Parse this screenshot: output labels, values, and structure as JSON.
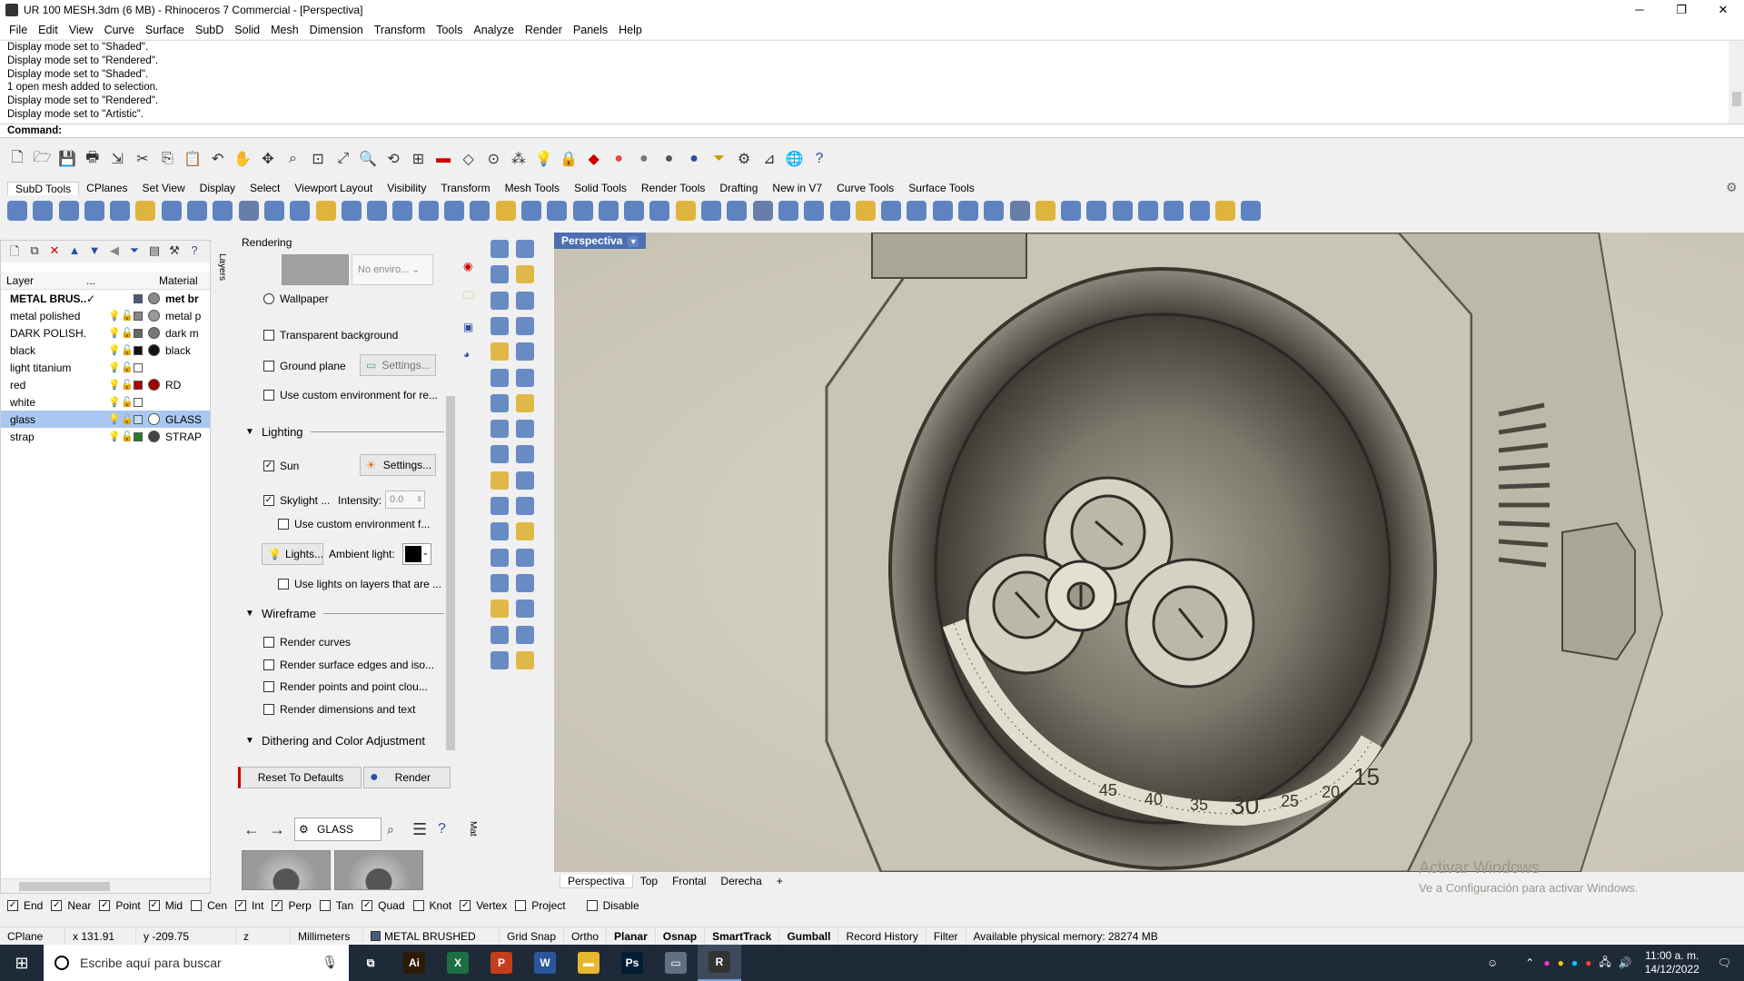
{
  "window": {
    "title": "UR 100 MESH.3dm (6 MB) - Rhinoceros 7 Commercial - [Perspectiva]",
    "minimize": "─",
    "maximize": "❐",
    "close": "✕"
  },
  "menu": [
    "File",
    "Edit",
    "View",
    "Curve",
    "Surface",
    "SubD",
    "Solid",
    "Mesh",
    "Dimension",
    "Transform",
    "Tools",
    "Analyze",
    "Render",
    "Panels",
    "Help"
  ],
  "history": [
    "Display mode set to \"Shaded\".",
    "Display mode set to \"Rendered\".",
    "Display mode set to \"Shaded\".",
    "1 open mesh added to selection.",
    "Display mode set to \"Rendered\".",
    "Display mode set to \"Artistic\"."
  ],
  "command": {
    "label": "Command:",
    "value": ""
  },
  "toolbar_tabs": [
    "SubD Tools",
    "CPlanes",
    "Set View",
    "Display",
    "Select",
    "Viewport Layout",
    "Visibility",
    "Transform",
    "Mesh Tools",
    "Solid Tools",
    "Render Tools",
    "Drafting",
    "New in V7",
    "Curve Tools",
    "Surface Tools"
  ],
  "layers": {
    "headers": {
      "layer": "Layer",
      "cur": "...",
      "material": "Material"
    },
    "rows": [
      {
        "name": "METAL BRUS...",
        "current": "✓",
        "color": "#4a5a7a",
        "mat_color": "#8a8a8a",
        "material": "met br",
        "bold": true,
        "selected": false
      },
      {
        "name": "metal polished",
        "current": "",
        "color": "#888888",
        "mat_color": "#999999",
        "material": "metal p",
        "bold": false,
        "selected": false
      },
      {
        "name": "DARK POLISH...",
        "current": "",
        "color": "#666666",
        "mat_color": "#777777",
        "material": "dark m",
        "bold": false,
        "selected": false
      },
      {
        "name": "black",
        "current": "",
        "color": "#111111",
        "mat_color": "#111111",
        "material": "black",
        "bold": false,
        "selected": false
      },
      {
        "name": "light titanium",
        "current": "",
        "color": "#ffffff",
        "mat_color": "",
        "material": "",
        "bold": false,
        "selected": false
      },
      {
        "name": "red",
        "current": "",
        "color": "#b00000",
        "mat_color": "#a00000",
        "material": "RD",
        "bold": false,
        "selected": false
      },
      {
        "name": "white",
        "current": "",
        "color": "#ffffff",
        "mat_color": "",
        "material": "",
        "bold": false,
        "selected": false
      },
      {
        "name": "glass",
        "current": "",
        "color": "#bfe0f5",
        "mat_color": "#ffffff",
        "material": "GLASS",
        "bold": false,
        "selected": true
      },
      {
        "name": "strap",
        "current": "",
        "color": "#2a7a2a",
        "mat_color": "#444444",
        "material": "STRAP",
        "bold": false,
        "selected": false
      }
    ],
    "side_tab": "Layers"
  },
  "rendering": {
    "title": "Rendering",
    "environment": "No enviro...",
    "wallpaper": "Wallpaper",
    "transparent_bg": "Transparent background",
    "ground_plane": "Ground plane",
    "settings": "Settings...",
    "custom_env_reflect": "Use custom environment for re...",
    "lighting": "Lighting",
    "sun": "Sun",
    "skylight": "Skylight ...",
    "intensity_label": "Intensity:",
    "intensity_value": "0.0",
    "custom_env_f": "Use custom environment f...",
    "lights": "Lights...",
    "ambient_light": "Ambient light:",
    "use_lights_layers": "Use lights on layers that are ...",
    "wireframe": "Wireframe",
    "render_curves": "Render curves",
    "render_surface_edges": "Render surface edges and iso...",
    "render_points": "Render points and point clou...",
    "render_dims": "Render dimensions and text",
    "dithering": "Dithering and Color Adjustment",
    "reset": "Reset To Defaults",
    "render": "Render"
  },
  "materials": {
    "search": "GLASS",
    "side_tab": "Mat"
  },
  "viewport": {
    "title": "Perspectiva",
    "watermark_title": "Activar Windows",
    "watermark_sub": "Ve a Configuración para activar Windows.",
    "tabs": [
      "Perspectiva",
      "Top",
      "Frontal",
      "Derecha"
    ],
    "add_tab": "+"
  },
  "osnap": [
    {
      "label": "End",
      "checked": true
    },
    {
      "label": "Near",
      "checked": true
    },
    {
      "label": "Point",
      "checked": true
    },
    {
      "label": "Mid",
      "checked": true
    },
    {
      "label": "Cen",
      "checked": false
    },
    {
      "label": "Int",
      "checked": true
    },
    {
      "label": "Perp",
      "checked": true
    },
    {
      "label": "Tan",
      "checked": false
    },
    {
      "label": "Quad",
      "checked": true
    },
    {
      "label": "Knot",
      "checked": false
    },
    {
      "label": "Vertex",
      "checked": true
    },
    {
      "label": "Project",
      "checked": false
    },
    {
      "label": "Disable",
      "checked": false
    }
  ],
  "status": {
    "cplane": "CPlane",
    "x": "x 131.91",
    "y": "y -209.75",
    "z": "z",
    "units": "Millimeters",
    "layer": "METAL BRUSHED",
    "grid_snap": "Grid Snap",
    "ortho": "Ortho",
    "planar": "Planar",
    "osnap": "Osnap",
    "smarttrack": "SmartTrack",
    "gumball": "Gumball",
    "record_history": "Record History",
    "filter": "Filter",
    "memory": "Available physical memory: 28274 MB"
  },
  "taskbar": {
    "search_placeholder": "Escribe aquí para buscar",
    "apps": [
      {
        "name": "task-view",
        "label": "⧉",
        "color": "#1f2a38"
      },
      {
        "name": "illustrator",
        "label": "Ai",
        "color": "#2e1a05"
      },
      {
        "name": "excel",
        "label": "X",
        "color": "#1d6f42"
      },
      {
        "name": "powerpoint",
        "label": "P",
        "color": "#c43e1c"
      },
      {
        "name": "word",
        "label": "W",
        "color": "#2b579a"
      },
      {
        "name": "file-explorer",
        "label": "▬",
        "color": "#e8b730"
      },
      {
        "name": "photoshop",
        "label": "Ps",
        "color": "#001d34"
      },
      {
        "name": "app-window",
        "label": "▭",
        "color": "#607080"
      },
      {
        "name": "rhino",
        "label": "R",
        "color": "#333333"
      }
    ],
    "time": "11:00 a. m.",
    "date": "14/12/2022"
  },
  "colors": {
    "accent": "#4b6fb0",
    "selection": "#a9c7f0",
    "viewport_bg": "#d3cfc2"
  }
}
